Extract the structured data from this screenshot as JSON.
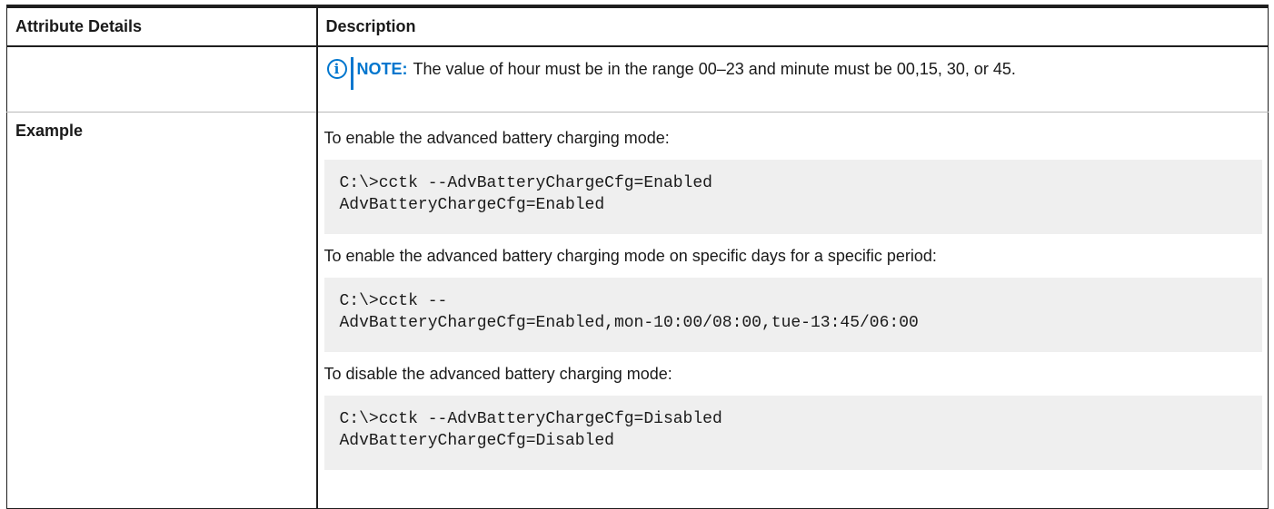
{
  "table": {
    "headers": {
      "attribute_details": "Attribute Details",
      "description": "Description"
    },
    "note_row": {
      "attribute": "",
      "icon": "info-icon",
      "note_label": "NOTE:",
      "note_text": "The value of hour must be in the range 00–23 and minute must be 00,15, 30, or 45."
    },
    "example_row": {
      "attribute": "Example",
      "items": [
        {
          "text": "To enable the advanced battery charging mode:",
          "code": "C:\\>cctk --AdvBatteryChargeCfg=Enabled\nAdvBatteryChargeCfg=Enabled"
        },
        {
          "text": "To enable the advanced battery charging mode on specific days for a specific period:",
          "code": "C:\\>cctk --\nAdvBatteryChargeCfg=Enabled,mon-10:00/08:00,tue-13:45/06:00"
        },
        {
          "text": "To disable the advanced battery charging mode:",
          "code": "C:\\>cctk --AdvBatteryChargeCfg=Disabled\nAdvBatteryChargeCfg=Disabled"
        }
      ]
    }
  },
  "colors": {
    "note_accent": "#0076ce",
    "code_background": "#efefef",
    "border": "#1e1e1e"
  }
}
